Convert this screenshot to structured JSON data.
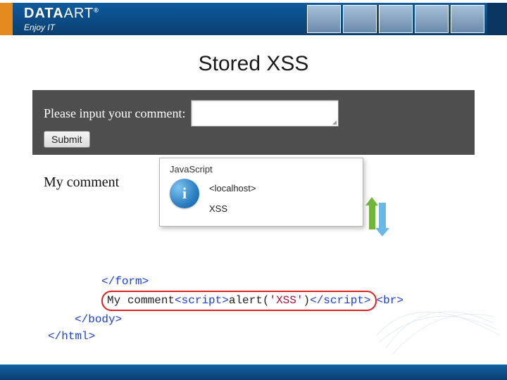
{
  "header": {
    "logo_main": "DATA",
    "logo_sub": "ART",
    "logo_reg": "®",
    "tagline": "Enjoy IT"
  },
  "title": "Stored XSS",
  "form": {
    "label": "Please input your comment:",
    "textarea_value": "",
    "submit_label": "Submit"
  },
  "output_label": "My comment",
  "alert": {
    "window_title": "JavaScript",
    "host": "<localhost>",
    "message": "XSS"
  },
  "code": {
    "line1_indent": "          ",
    "line1": "</form>",
    "line2_indent": "          ",
    "line2_text": "My comment",
    "line2_script_open": "<script>",
    "line2_alert": "alert",
    "line2_paren_open": "(",
    "line2_str": "'XSS'",
    "line2_paren_close": ")",
    "line2_script_close": "</script>",
    "line2_br": "<br>",
    "line3_indent": "     ",
    "line3": "</body>",
    "line4": "</html>"
  }
}
